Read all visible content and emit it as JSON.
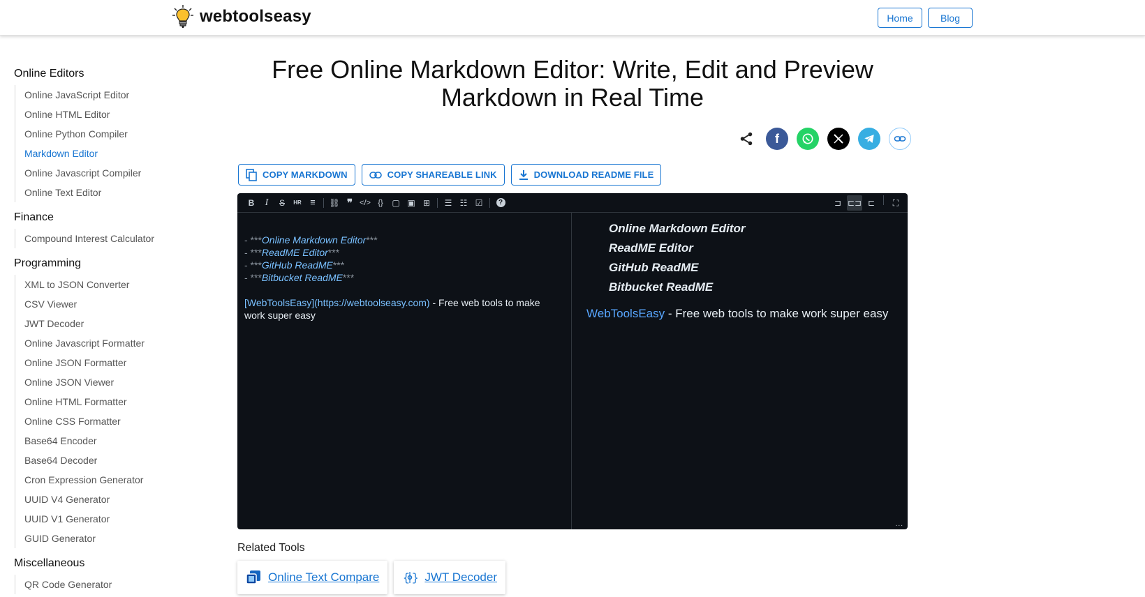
{
  "header": {
    "logo_text": "webtoolseasy",
    "nav": [
      {
        "label": "Home"
      },
      {
        "label": "Blog"
      }
    ]
  },
  "sidebar": {
    "categories": [
      {
        "title": "Online Editors",
        "items": [
          "Online JavaScript Editor",
          "Online HTML Editor",
          "Online Python Compiler",
          "Markdown Editor",
          "Online Javascript Compiler",
          "Online Text Editor"
        ],
        "active": "Markdown Editor"
      },
      {
        "title": "Finance",
        "items": [
          "Compound Interest Calculator"
        ]
      },
      {
        "title": "Programming",
        "items": [
          "XML to JSON Converter",
          "CSV Viewer",
          "JWT Decoder",
          "Online Javascript Formatter",
          "Online JSON Formatter",
          "Online JSON Viewer",
          "Online HTML Formatter",
          "Online CSS Formatter",
          "Base64 Encoder",
          "Base64 Decoder",
          "Cron Expression Generator",
          "UUID V4 Generator",
          "UUID V1 Generator",
          "GUID Generator"
        ]
      },
      {
        "title": "Miscellaneous",
        "items": [
          "QR Code Generator"
        ]
      }
    ]
  },
  "main": {
    "title_line1": "Free Online Markdown Editor: Write, Edit and Preview",
    "title_line2": "Markdown in Real Time",
    "share_icons": [
      "share-icon",
      "facebook-icon",
      "whatsapp-icon",
      "x-icon",
      "telegram-icon",
      "link-icon"
    ],
    "actions": [
      {
        "label": "COPY MARKDOWN",
        "icon": "copy-icon"
      },
      {
        "label": "COPY SHAREABLE LINK",
        "icon": "link-icon"
      },
      {
        "label": "DOWNLOAD README FILE",
        "icon": "download-icon"
      }
    ]
  },
  "editor": {
    "source_lines": [
      {
        "prefix": "- ***",
        "text": "Online Markdown Editor",
        "suffix": "***"
      },
      {
        "prefix": "- ***",
        "text": "ReadME Editor",
        "suffix": "***"
      },
      {
        "prefix": "- ***",
        "text": "GitHub ReadME",
        "suffix": "***"
      },
      {
        "prefix": "- ***",
        "text": "Bitbucket ReadME",
        "suffix": "***"
      }
    ],
    "source_link": "[WebToolsEasy](https://webtoolseasy.com)",
    "source_link_rest": " - Free web tools to make",
    "source_link_rest2": "work super easy",
    "preview_items": [
      "Online Markdown Editor",
      "ReadME Editor",
      "GitHub ReadME",
      "Bitbucket ReadME"
    ],
    "preview_link": "WebToolsEasy",
    "preview_rest": " - Free web tools to make work super easy",
    "resize_glyph": "..."
  },
  "related": {
    "title": "Related Tools",
    "items": [
      {
        "label": "Online Text Compare",
        "icon": "compare-icon"
      },
      {
        "label": "JWT Decoder",
        "icon": "jwt-icon"
      }
    ]
  },
  "colors": {
    "accent": "#1976d2",
    "editor_bg": "#0d1117",
    "facebook": "#3b5998",
    "whatsapp": "#25d366",
    "x": "#000000",
    "telegram": "#37aee2"
  }
}
